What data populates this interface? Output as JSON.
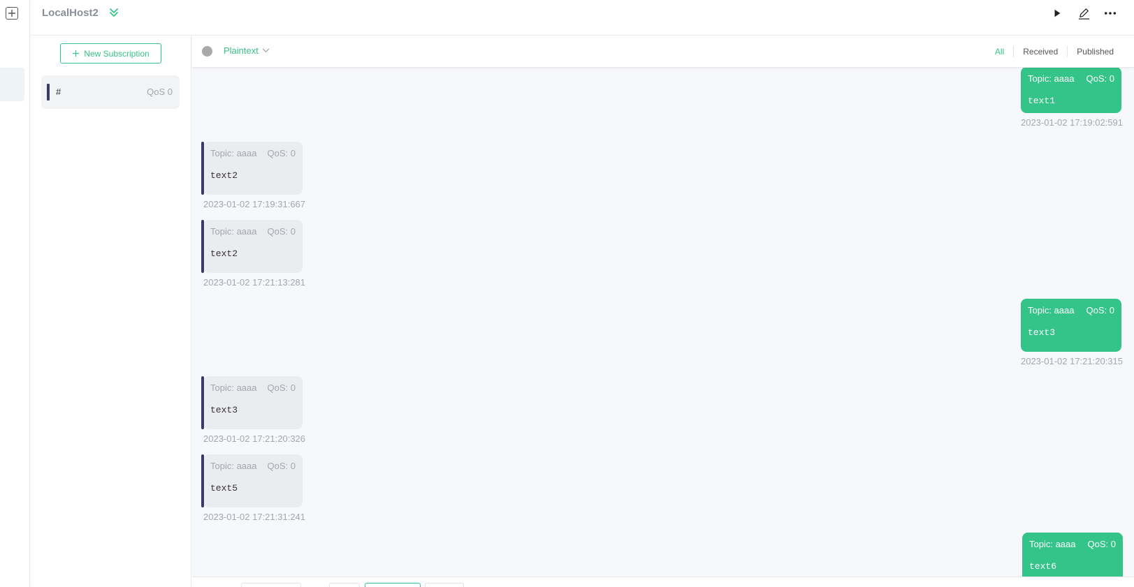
{
  "header": {
    "title": "LocalHost2",
    "toggle_icon": "chevron-double-down-icon",
    "actions": [
      "play-icon",
      "edit-icon",
      "more-icon"
    ]
  },
  "subscriptions": {
    "new_button_label": "New Subscription",
    "items": [
      {
        "topic": "#",
        "qos": "QoS 0",
        "color": "#3d3a6a"
      }
    ]
  },
  "toolbar": {
    "payload_type": "Plaintext",
    "filters": {
      "all": "All",
      "received": "Received",
      "published": "Published"
    },
    "active_filter": "All"
  },
  "messages": [
    {
      "direction": "sent",
      "topic": "Topic: aaaa",
      "qos": "QoS: 0",
      "payload": "text1",
      "time": "2023-01-02 17:19:02:591"
    },
    {
      "direction": "received",
      "topic": "Topic: aaaa",
      "qos": "QoS: 0",
      "payload": "text2",
      "time": "2023-01-02 17:19:31:667"
    },
    {
      "direction": "received",
      "topic": "Topic: aaaa",
      "qos": "QoS: 0",
      "payload": "text2",
      "time": "2023-01-02 17:21:13:281"
    },
    {
      "direction": "sent",
      "topic": "Topic: aaaa",
      "qos": "QoS: 0",
      "payload": "text3",
      "time": "2023-01-02 17:21:20:315"
    },
    {
      "direction": "received",
      "topic": "Topic: aaaa",
      "qos": "QoS: 0",
      "payload": "text3",
      "time": "2023-01-02 17:21:20:326"
    },
    {
      "direction": "received",
      "topic": "Topic: aaaa",
      "qos": "QoS: 0",
      "payload": "text5",
      "time": "2023-01-02 17:21:31:241"
    },
    {
      "direction": "sent",
      "topic": "Topic: aaaa",
      "qos": "QoS: 0",
      "payload": "text6",
      "time": ""
    }
  ],
  "colors": {
    "accent": "#34c388",
    "received_bar": "#3d3a6a",
    "received_bubble": "#ebecef",
    "background": "#f7f8fb"
  }
}
